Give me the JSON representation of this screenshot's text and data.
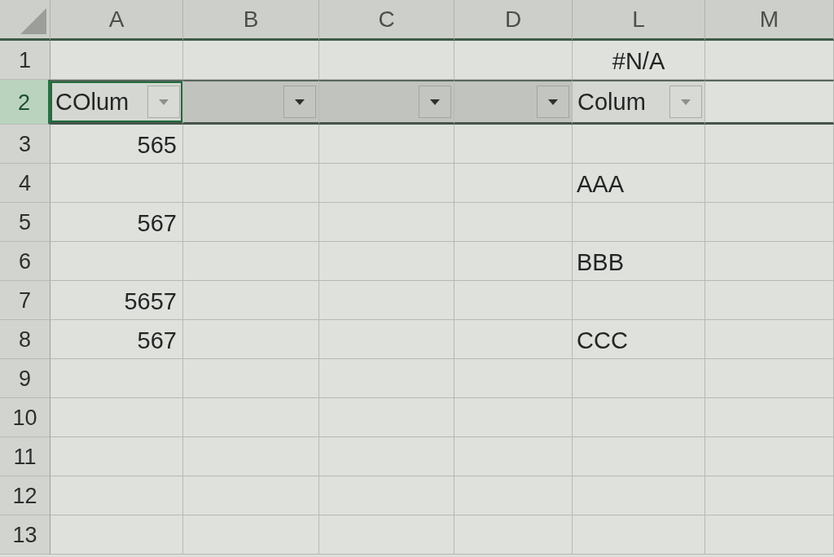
{
  "columns": [
    {
      "label": "A"
    },
    {
      "label": "B"
    },
    {
      "label": "C"
    },
    {
      "label": "D"
    },
    {
      "label": "L"
    },
    {
      "label": "M"
    }
  ],
  "rows": [
    {
      "number": "1",
      "selected": false,
      "cells": [
        {
          "kind": "empty",
          "selected": false
        },
        {
          "kind": "empty",
          "selected": false
        },
        {
          "kind": "empty",
          "selected": false
        },
        {
          "kind": "empty",
          "selected": false
        },
        {
          "kind": "error",
          "value": "#N/A",
          "selected": false
        },
        {
          "kind": "empty",
          "selected": false
        }
      ]
    },
    {
      "number": "2",
      "selected": true,
      "cells": [
        {
          "kind": "header",
          "value": "COlum",
          "shaded": false,
          "filter": true,
          "selected": true
        },
        {
          "kind": "header",
          "shaded": true,
          "filter": true,
          "selected": false
        },
        {
          "kind": "header",
          "shaded": true,
          "filter": true,
          "selected": false
        },
        {
          "kind": "header",
          "shaded": true,
          "filter": true,
          "selected": false
        },
        {
          "kind": "header",
          "value": "Colum",
          "shaded": false,
          "filter": true,
          "selected": false
        },
        {
          "kind": "empty",
          "selected": false
        }
      ]
    },
    {
      "number": "3",
      "selected": false,
      "cells": [
        {
          "kind": "number",
          "value": "565",
          "selected": false
        },
        {
          "kind": "empty",
          "selected": false
        },
        {
          "kind": "empty",
          "selected": false
        },
        {
          "kind": "empty",
          "selected": false
        },
        {
          "kind": "empty",
          "selected": false
        },
        {
          "kind": "empty",
          "selected": false
        }
      ]
    },
    {
      "number": "4",
      "selected": false,
      "cells": [
        {
          "kind": "empty",
          "selected": false
        },
        {
          "kind": "empty",
          "selected": false
        },
        {
          "kind": "empty",
          "selected": false
        },
        {
          "kind": "empty",
          "selected": false
        },
        {
          "kind": "text",
          "value": "AAA",
          "selected": false
        },
        {
          "kind": "empty",
          "selected": false
        }
      ]
    },
    {
      "number": "5",
      "selected": false,
      "cells": [
        {
          "kind": "number",
          "value": "567",
          "selected": false
        },
        {
          "kind": "empty",
          "selected": false
        },
        {
          "kind": "empty",
          "selected": false
        },
        {
          "kind": "empty",
          "selected": false
        },
        {
          "kind": "empty",
          "selected": false
        },
        {
          "kind": "empty",
          "selected": false
        }
      ]
    },
    {
      "number": "6",
      "selected": false,
      "cells": [
        {
          "kind": "empty",
          "selected": false
        },
        {
          "kind": "empty",
          "selected": false
        },
        {
          "kind": "empty",
          "selected": false
        },
        {
          "kind": "empty",
          "selected": false
        },
        {
          "kind": "text",
          "value": "BBB",
          "selected": false
        },
        {
          "kind": "empty",
          "selected": false
        }
      ]
    },
    {
      "number": "7",
      "selected": false,
      "cells": [
        {
          "kind": "number",
          "value": "5657",
          "selected": false
        },
        {
          "kind": "empty",
          "selected": false
        },
        {
          "kind": "empty",
          "selected": false
        },
        {
          "kind": "empty",
          "selected": false
        },
        {
          "kind": "empty",
          "selected": false
        },
        {
          "kind": "empty",
          "selected": false
        }
      ]
    },
    {
      "number": "8",
      "selected": false,
      "cells": [
        {
          "kind": "number",
          "value": "567",
          "selected": false
        },
        {
          "kind": "empty",
          "selected": false
        },
        {
          "kind": "empty",
          "selected": false
        },
        {
          "kind": "empty",
          "selected": false
        },
        {
          "kind": "text",
          "value": "CCC",
          "selected": false
        },
        {
          "kind": "empty",
          "selected": false
        }
      ]
    },
    {
      "number": "9",
      "selected": false,
      "cells": [
        {
          "kind": "empty",
          "selected": false
        },
        {
          "kind": "empty",
          "selected": false
        },
        {
          "kind": "empty",
          "selected": false
        },
        {
          "kind": "empty",
          "selected": false
        },
        {
          "kind": "empty",
          "selected": false
        },
        {
          "kind": "empty",
          "selected": false
        }
      ]
    },
    {
      "number": "10",
      "selected": false,
      "cells": [
        {
          "kind": "empty",
          "selected": false
        },
        {
          "kind": "empty",
          "selected": false
        },
        {
          "kind": "empty",
          "selected": false
        },
        {
          "kind": "empty",
          "selected": false
        },
        {
          "kind": "empty",
          "selected": false
        },
        {
          "kind": "empty",
          "selected": false
        }
      ]
    },
    {
      "number": "11",
      "selected": false,
      "cells": [
        {
          "kind": "empty",
          "selected": false
        },
        {
          "kind": "empty",
          "selected": false
        },
        {
          "kind": "empty",
          "selected": false
        },
        {
          "kind": "empty",
          "selected": false
        },
        {
          "kind": "empty",
          "selected": false
        },
        {
          "kind": "empty",
          "selected": false
        }
      ]
    },
    {
      "number": "12",
      "selected": false,
      "cells": [
        {
          "kind": "empty",
          "selected": false
        },
        {
          "kind": "empty",
          "selected": false
        },
        {
          "kind": "empty",
          "selected": false
        },
        {
          "kind": "empty",
          "selected": false
        },
        {
          "kind": "empty",
          "selected": false
        },
        {
          "kind": "empty",
          "selected": false
        }
      ]
    },
    {
      "number": "13",
      "selected": false,
      "cells": [
        {
          "kind": "empty",
          "selected": false
        },
        {
          "kind": "empty",
          "selected": false
        },
        {
          "kind": "empty",
          "selected": false
        },
        {
          "kind": "empty",
          "selected": false
        },
        {
          "kind": "empty",
          "selected": false
        },
        {
          "kind": "empty",
          "selected": false
        }
      ]
    }
  ]
}
